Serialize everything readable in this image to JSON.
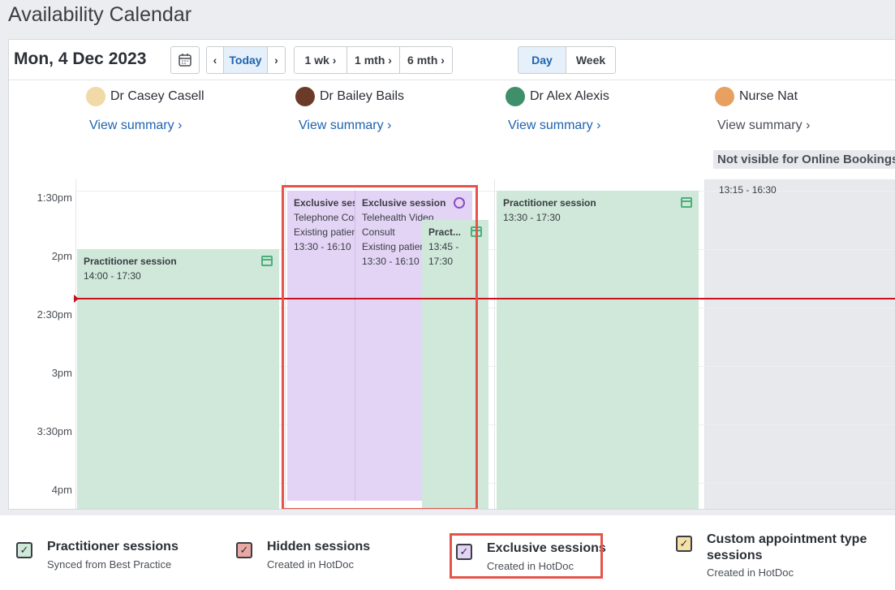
{
  "page_title": "Availability Calendar",
  "toolbar": {
    "date": "Mon, 4 Dec 2023",
    "calendar_icon": "calendar-icon",
    "prev": "‹",
    "today": "Today",
    "next": "›",
    "ranges": [
      "1 wk ›",
      "1 mth ›",
      "6 mth ›"
    ],
    "views": [
      "Day",
      "Week"
    ],
    "active_view": "Day"
  },
  "practitioners": [
    {
      "name": "Dr Casey Casell",
      "summary": "View summary ›",
      "avatar_color": "#f1d9a8"
    },
    {
      "name": "Dr Bailey Bails",
      "summary": "View summary ›",
      "avatar_color": "#6b3b2a"
    },
    {
      "name": "Dr Alex Alexis",
      "summary": "View summary ›",
      "avatar_color": "#3f8f6a"
    },
    {
      "name": "Nurse Nat",
      "summary": "View summary ›",
      "avatar_color": "#e8a060",
      "badge": "Not visible for Online Bookings",
      "range": "13:15 - 16:30"
    }
  ],
  "times": [
    "1:30pm",
    "2pm",
    "2:30pm",
    "3pm",
    "3:30pm",
    "4pm"
  ],
  "events": {
    "casey": {
      "title": "Practitioner session",
      "time": "14:00 - 17:30"
    },
    "bailey_ex1": {
      "title": "Exclusive sessions",
      "line1": "Telephone Consult",
      "line2": "Existing patients",
      "time": "13:30 - 16:10"
    },
    "bailey_ex2": {
      "title": "Exclusive session",
      "line1": "Telehealth Video",
      "line2": "Consult",
      "line3": "Existing patients",
      "time": "13:30 - 16:10"
    },
    "bailey_pr": {
      "title": "Pract...",
      "time": "13:45 - 17:30"
    },
    "alex": {
      "title": "Practitioner session",
      "time": "13:30 - 17:30"
    }
  },
  "legend": [
    {
      "title": "Practitioner sessions",
      "sub": "Synced from Best Practice",
      "color": "#cfe8da"
    },
    {
      "title": "Hidden sessions",
      "sub": "Created in HotDoc",
      "color": "#e8a9a4"
    },
    {
      "title": "Exclusive sessions",
      "sub": "Created in HotDoc",
      "color": "#e3d4f6"
    },
    {
      "title": "Custom appointment type sessions",
      "sub": "Created in HotDoc",
      "color": "#f5e0a8"
    }
  ],
  "colors": {
    "accent": "#1f63b0",
    "highlight": "#e5544c",
    "now_line": "#c8101e"
  }
}
